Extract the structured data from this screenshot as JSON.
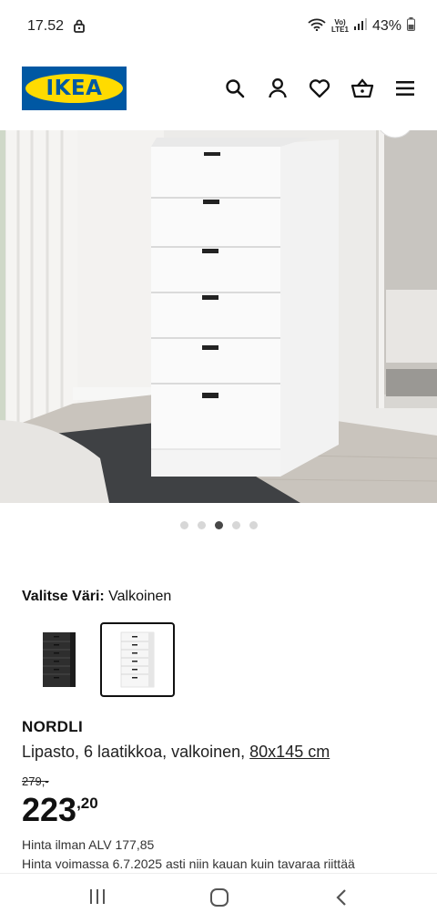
{
  "status_bar": {
    "time": "17.52",
    "volte_label": "Vo)",
    "lte_label": "LTE1",
    "battery": "43%"
  },
  "header": {
    "logo_text": "IKEA",
    "icons": [
      "search-icon",
      "profile-icon",
      "heart-icon",
      "basket-icon",
      "menu-icon"
    ]
  },
  "carousel": {
    "total": 5,
    "active_index": 2
  },
  "color_selector": {
    "label": "Valitse Väri:",
    "selected": "Valkoinen",
    "options": [
      "black",
      "white"
    ]
  },
  "product": {
    "name": "NORDLI",
    "description": "Lipasto, 6 laatikkoa, valkoinen, ",
    "size_link": "80x145 cm",
    "old_price": "279,-",
    "price_int": "223",
    "price_dec": ",20",
    "vat_text": "Hinta ilman ALV 177,85",
    "validity_text": "Hinta voimassa 6.7.2025 asti niin kauan kuin tavaraa riittää"
  },
  "colors": {
    "ikea_blue": "#0058a3",
    "ikea_yellow": "#ffdb00"
  }
}
